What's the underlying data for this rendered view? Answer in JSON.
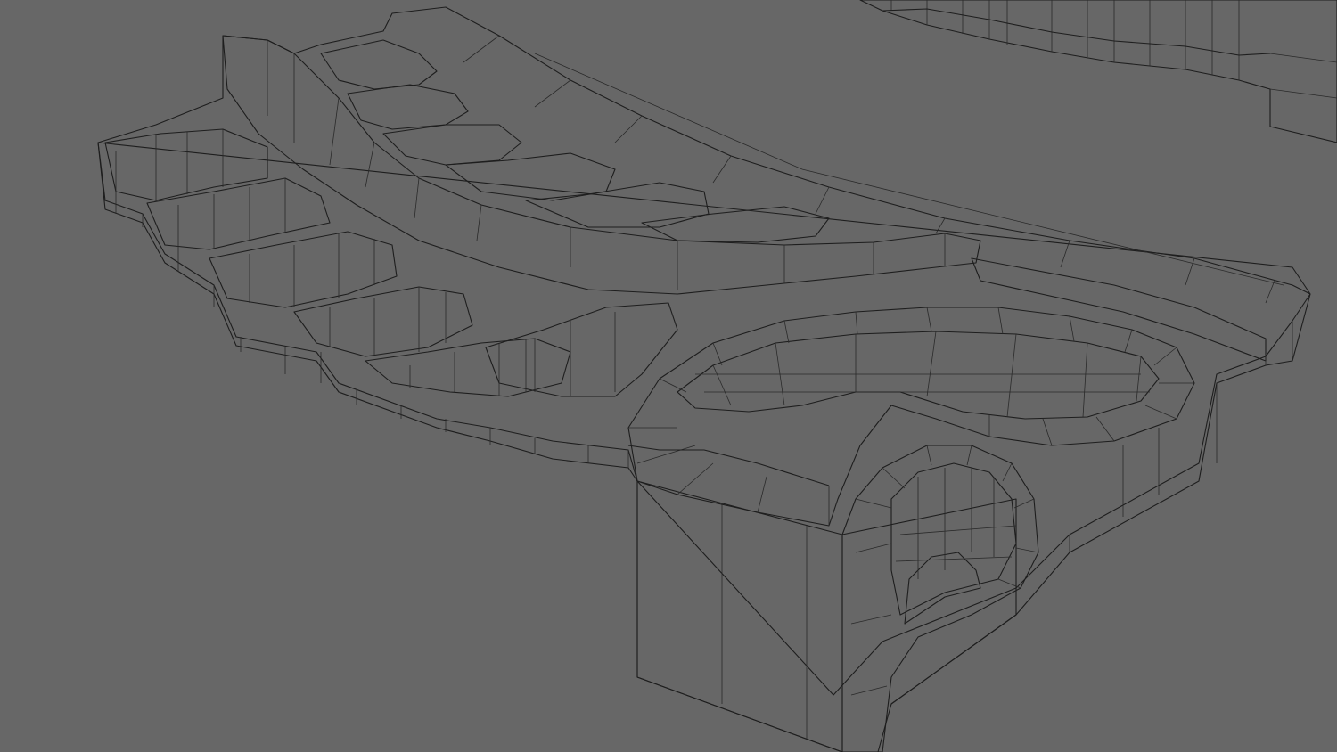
{
  "scene": {
    "background_color": "#676767",
    "mesh_light": "#e6e6e6",
    "mesh_mid": "#cfcfcf",
    "mesh_shadow": "#a9a9a9",
    "wire_color": "#1e1e1e"
  }
}
